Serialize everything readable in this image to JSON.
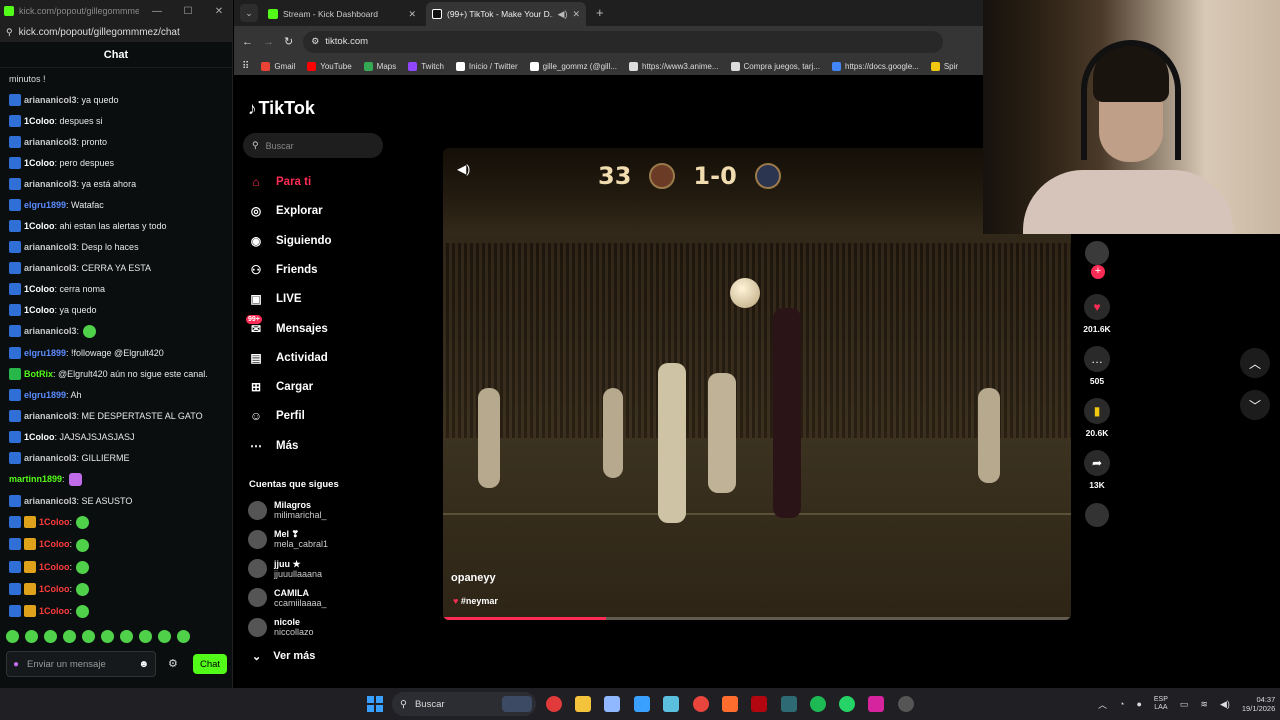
{
  "chat_window": {
    "tab_title": "kick.com/popout/gillegommmez/...",
    "url": "kick.com/popout/gillegommmez/chat",
    "header": "Chat",
    "first_line": "minutos !",
    "messages": [
      {
        "user": "ariananicol3",
        "text": ": ya quedo",
        "badge": "blue",
        "color": "#c9c9c9"
      },
      {
        "user": "1Coloo",
        "text": ": despues si",
        "badge": "blue",
        "color": "#ffffff"
      },
      {
        "user": "ariananicol3",
        "text": ": pronto",
        "badge": "blue",
        "color": "#c9c9c9"
      },
      {
        "user": "1Coloo",
        "text": ": pero despues",
        "badge": "blue",
        "color": "#ffffff"
      },
      {
        "user": "ariananicol3",
        "text": ": ya está ahora",
        "badge": "blue",
        "color": "#c9c9c9"
      },
      {
        "user": "elgru1899",
        "text": ": Watafac",
        "badge": "blue",
        "color": "#5b8cff"
      },
      {
        "user": "1Coloo",
        "text": ": ahi estan las alertas y todo",
        "badge": "blue",
        "color": "#ffffff"
      },
      {
        "user": "ariananicol3",
        "text": ": Desp lo haces",
        "badge": "blue",
        "color": "#c9c9c9"
      },
      {
        "user": "ariananicol3",
        "text": ": CERRA YA ESTA",
        "badge": "blue",
        "color": "#c9c9c9"
      },
      {
        "user": "1Coloo",
        "text": ": cerra noma",
        "badge": "blue",
        "color": "#ffffff"
      },
      {
        "user": "1Coloo",
        "text": ": ya quedo",
        "badge": "blue",
        "color": "#ffffff"
      },
      {
        "user": "ariananicol3",
        "text": ":",
        "badge": "blue",
        "color": "#c9c9c9",
        "emote": "green"
      },
      {
        "user": "elgru1899",
        "text": ": !followage @Elgrult420",
        "badge": "blue",
        "color": "#5b8cff"
      },
      {
        "user": "BotRix",
        "text": ": @Elgrult420 aún no sigue este canal.",
        "badge": "green",
        "color": "#53fc18"
      },
      {
        "user": "elgru1899",
        "text": ": Ah",
        "badge": "blue",
        "color": "#5b8cff"
      },
      {
        "user": "ariananicol3",
        "text": ": ME DESPERTASTE AL GATO",
        "badge": "blue",
        "color": "#c9c9c9"
      },
      {
        "user": "1Coloo",
        "text": ": JAJSAJSJASJASJ",
        "badge": "blue",
        "color": "#ffffff"
      },
      {
        "user": "ariananicol3",
        "text": ": GILLIERME",
        "badge": "blue",
        "color": "#c9c9c9"
      },
      {
        "user": "martinn1899",
        "text": ":",
        "badge": "none",
        "color": "#53fc18",
        "emote": "purple"
      },
      {
        "user": "ariananicol3",
        "text": ": SE ASUSTO",
        "badge": "blue",
        "color": "#c9c9c9"
      },
      {
        "user": "1Coloo",
        "text": ":",
        "badge": "gold",
        "color": "#ff3b3b",
        "emote": "green"
      },
      {
        "user": "1Coloo",
        "text": ":",
        "badge": "gold",
        "color": "#ff3b3b",
        "emote": "green"
      },
      {
        "user": "1Coloo",
        "text": ":",
        "badge": "gold",
        "color": "#ff3b3b",
        "emote": "green"
      },
      {
        "user": "1Coloo",
        "text": ":",
        "badge": "gold",
        "color": "#ff3b3b",
        "emote": "green"
      },
      {
        "user": "1Coloo",
        "text": ":",
        "badge": "gold",
        "color": "#ff3b3b",
        "emote": "green"
      }
    ],
    "input_placeholder": "Enviar un mensaje",
    "send_label": "Chat"
  },
  "browser": {
    "tabs": [
      {
        "label": "Stream - Kick Dashboard",
        "icon": "kick-icon",
        "color": "#53fc18"
      },
      {
        "label": "(99+) TikTok - Make Your D...",
        "icon": "tiktok-icon",
        "color": "#ffffff"
      }
    ],
    "url": "tiktok.com",
    "bookmarks": [
      {
        "label": "Gmail",
        "color": "#ea4335"
      },
      {
        "label": "YouTube",
        "color": "#ff0000"
      },
      {
        "label": "Maps",
        "color": "#34a853"
      },
      {
        "label": "Twitch",
        "color": "#9146ff"
      },
      {
        "label": "Inicio / Twitter",
        "color": "#ffffff"
      },
      {
        "label": "gille_gommz (@gill...",
        "color": "#ffffff"
      },
      {
        "label": "https://www3.anime...",
        "color": "#dddddd"
      },
      {
        "label": "Compra juegos, tarj...",
        "color": "#dddddd"
      },
      {
        "label": "https://docs.google...",
        "color": "#4285f4"
      },
      {
        "label": "Spir",
        "color": "#f2c811"
      }
    ]
  },
  "tiktok": {
    "logo": "TikTok",
    "search_placeholder": "Buscar",
    "nav": [
      {
        "label": "Para ti",
        "icon": "home-icon",
        "active": true
      },
      {
        "label": "Explorar",
        "icon": "compass-icon"
      },
      {
        "label": "Siguiendo",
        "icon": "following-icon"
      },
      {
        "label": "Friends",
        "icon": "friends-icon"
      },
      {
        "label": "LIVE",
        "icon": "live-icon"
      },
      {
        "label": "Mensajes",
        "icon": "messages-icon",
        "badge": "99+"
      },
      {
        "label": "Actividad",
        "icon": "activity-icon"
      },
      {
        "label": "Cargar",
        "icon": "upload-icon"
      },
      {
        "label": "Perfil",
        "icon": "profile-icon"
      },
      {
        "label": "Más",
        "icon": "more-icon"
      }
    ],
    "following_title": "Cuentas que sigues",
    "accounts": [
      {
        "name": "Milagros",
        "handle": "milimarichal_"
      },
      {
        "name": "Mel ❣",
        "handle": "mela_cabral1"
      },
      {
        "name": "jjuu ★",
        "handle": "jjuuullaaana"
      },
      {
        "name": "CAMILA",
        "handle": "ccamiilaaaa_"
      },
      {
        "name": "nicole",
        "handle": "niccollazo"
      }
    ],
    "see_more": "Ver más",
    "video": {
      "score_minute": "33",
      "score": "1-0",
      "creator": "opaneyy",
      "hashtag": "#neymar",
      "progress_fraction": 0.26
    },
    "actions": {
      "likes": "201.6K",
      "comments": "505",
      "saves": "20.6K",
      "shares": "13K"
    }
  },
  "taskbar": {
    "search_placeholder": "Buscar",
    "lang_top": "ESP",
    "lang_bottom": "LAA",
    "time": "04:37",
    "date": "19/1/2026"
  }
}
